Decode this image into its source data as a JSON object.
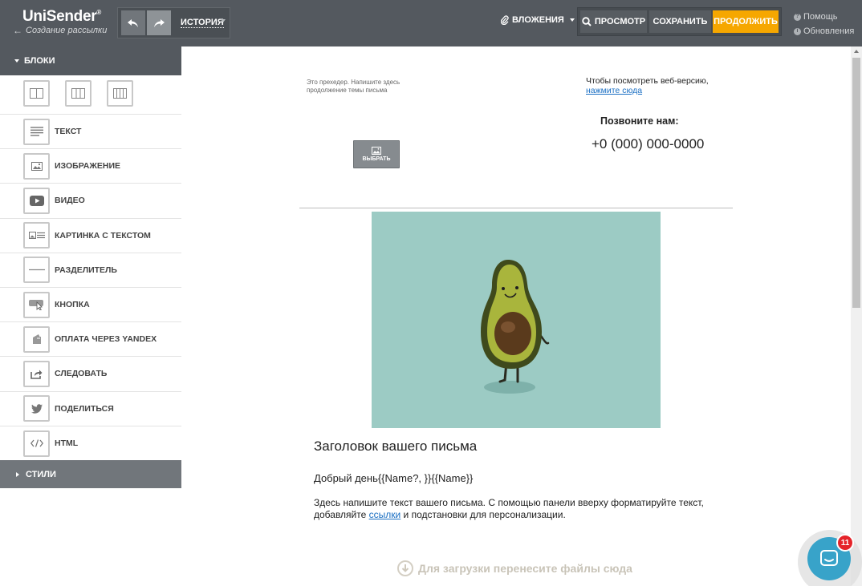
{
  "header": {
    "logo_name": "UniSender",
    "logo_reg": "®",
    "subtitle": "Создание рассылки",
    "history_label": "ИСТОРИЯ",
    "attachments_label": "ВЛОЖЕНИЯ",
    "preview_label": "ПРОСМОТР",
    "save_label": "СОХРАНИТЬ",
    "continue_label": "ПРОДОЛЖИТЬ",
    "help_label": "Помощь",
    "updates_label": "Обновления"
  },
  "sidebar": {
    "blocks_header": "БЛОКИ",
    "styles_header": "СТИЛИ",
    "items": [
      {
        "label": "ТЕКСТ",
        "icon": "text-icon"
      },
      {
        "label": "ИЗОБРАЖЕНИЕ",
        "icon": "image-icon"
      },
      {
        "label": "ВИДЕО",
        "icon": "video-icon"
      },
      {
        "label": "КАРТИНКА С ТЕКСТОМ",
        "icon": "image-text-icon"
      },
      {
        "label": "РАЗДЕЛИТЕЛЬ",
        "icon": "divider-icon"
      },
      {
        "label": "КНОПКА",
        "icon": "button-icon"
      },
      {
        "label": "ОПЛАТА ЧЕРЕЗ YANDEX",
        "icon": "wallet-icon"
      },
      {
        "label": "СЛЕДОВАТЬ",
        "icon": "share-out-icon"
      },
      {
        "label": "ПОДЕЛИТЬСЯ",
        "icon": "twitter-icon"
      },
      {
        "label": "HTML",
        "icon": "code-icon"
      }
    ]
  },
  "email": {
    "preheader": "Это прехедер. Напишите здесь продолжение темы письма",
    "webversion_text": "Чтобы посмотреть веб-версию,",
    "webversion_link": "нажмите сюда",
    "call_label": "Позвоните нам:",
    "phone": "+0 (000) 000-0000",
    "choose_label": "ВЫБРАТЬ",
    "title": "Заголовок вашего письма",
    "greeting": "Добрый день{{Name?, }}{{Name}}",
    "body_before_link": "Здесь напишите текст вашего письма. С помощью панели вверху форматируйте текст, добавляйте ",
    "body_link": "ссылки",
    "body_after_link": " и подстановки для персонализации.",
    "dropzone": "Для загрузки перенесите файлы сюда"
  },
  "chat": {
    "badge_count": "11"
  },
  "colors": {
    "topbar": "#54595f",
    "accent": "#f6a700",
    "link": "#1a6fc3",
    "hero_bg": "#9ccbc4",
    "chat": "#38a3c9",
    "badge": "#e5242a"
  }
}
